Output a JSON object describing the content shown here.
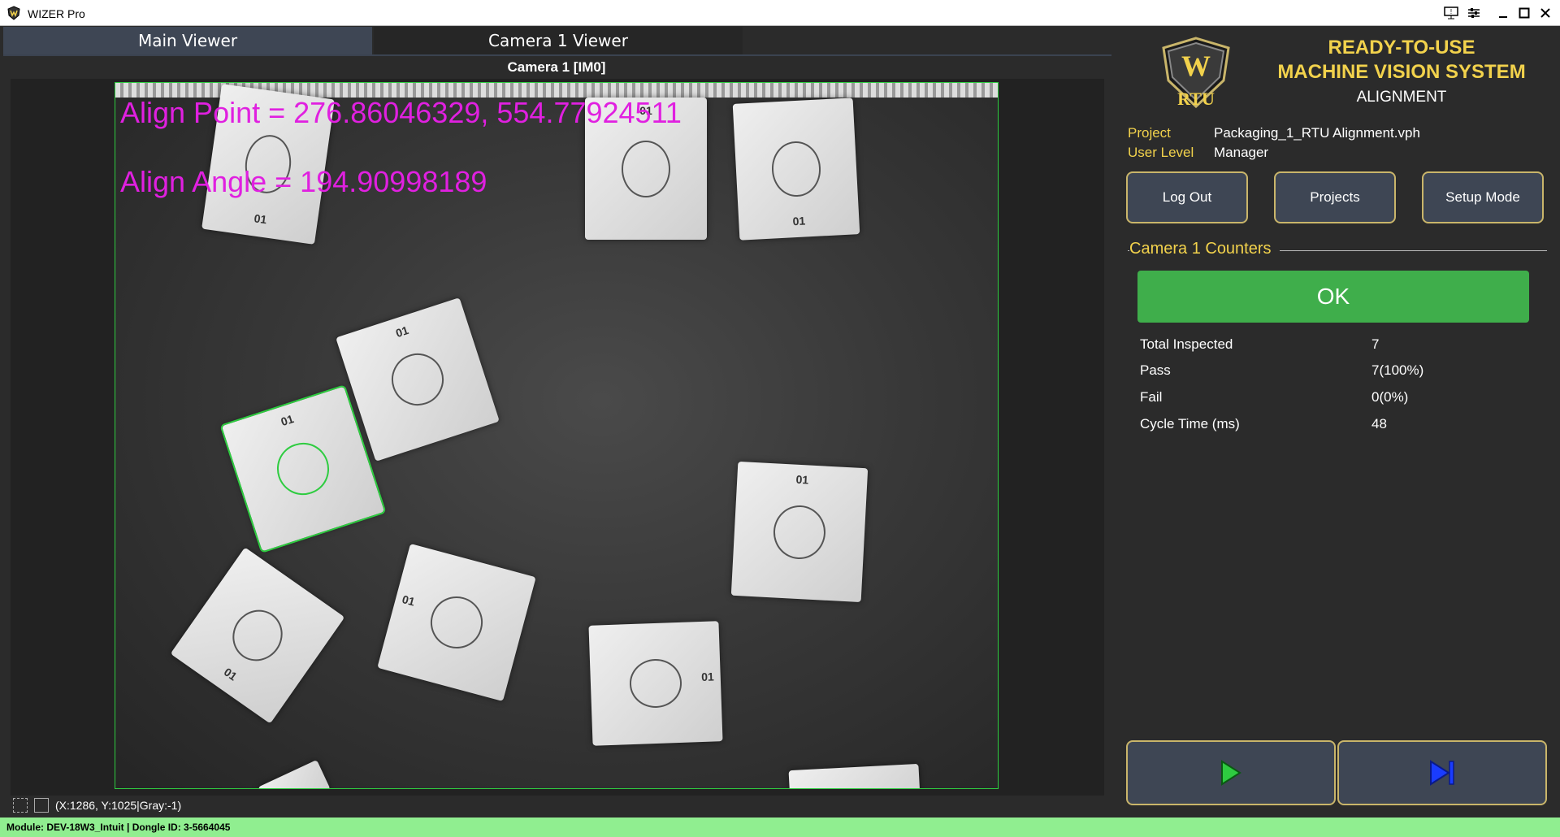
{
  "window": {
    "title": "WIZER Pro",
    "controls": [
      "monitor-icon",
      "settings-icon",
      "minimize-icon",
      "maximize-icon",
      "close-icon"
    ]
  },
  "tabs": [
    {
      "label": "Main Viewer",
      "active": true
    },
    {
      "label": "Camera 1 Viewer",
      "active": false
    }
  ],
  "viewer": {
    "camera_title": "Camera 1  [IM0]",
    "align_point": "Align Point = 276.86046329, 554.77924511",
    "align_angle": "Align Angle = 194.90998189",
    "package_label": "01",
    "coord_status": "(X:1286, Y:1025|Gray:-1)"
  },
  "brand": {
    "line1": "READY-TO-USE",
    "line2": "MACHINE VISION SYSTEM",
    "line3": "ALIGNMENT",
    "logo_text": "RTU"
  },
  "info": {
    "project_label": "Project",
    "project_value": "Packaging_1_RTU Alignment.vph",
    "user_level_label": "User Level",
    "user_level_value": "Manager"
  },
  "buttons": {
    "log_out": "Log Out",
    "projects": "Projects",
    "setup_mode": "Setup Mode"
  },
  "counters": {
    "title": "Camera 1 Counters",
    "status": "OK",
    "status_color": "#3fae4b",
    "rows": [
      {
        "label": "Total Inspected",
        "value": "7"
      },
      {
        "label": "Pass",
        "value": "7(100%)"
      },
      {
        "label": "Fail",
        "value": "0(0%)"
      },
      {
        "label": "Cycle Time (ms)",
        "value": "48"
      }
    ]
  },
  "controls": {
    "run_icon": "play-icon",
    "step_icon": "step-forward-icon"
  },
  "footer": {
    "text": "Module: DEV-18W3_Intuit | Dongle ID: 3-5664045"
  },
  "colors": {
    "accent_gold": "#f2d24c",
    "overlay_magenta": "#e020e0",
    "roi_green": "#2ecc40",
    "footer_green": "#90ee90"
  }
}
